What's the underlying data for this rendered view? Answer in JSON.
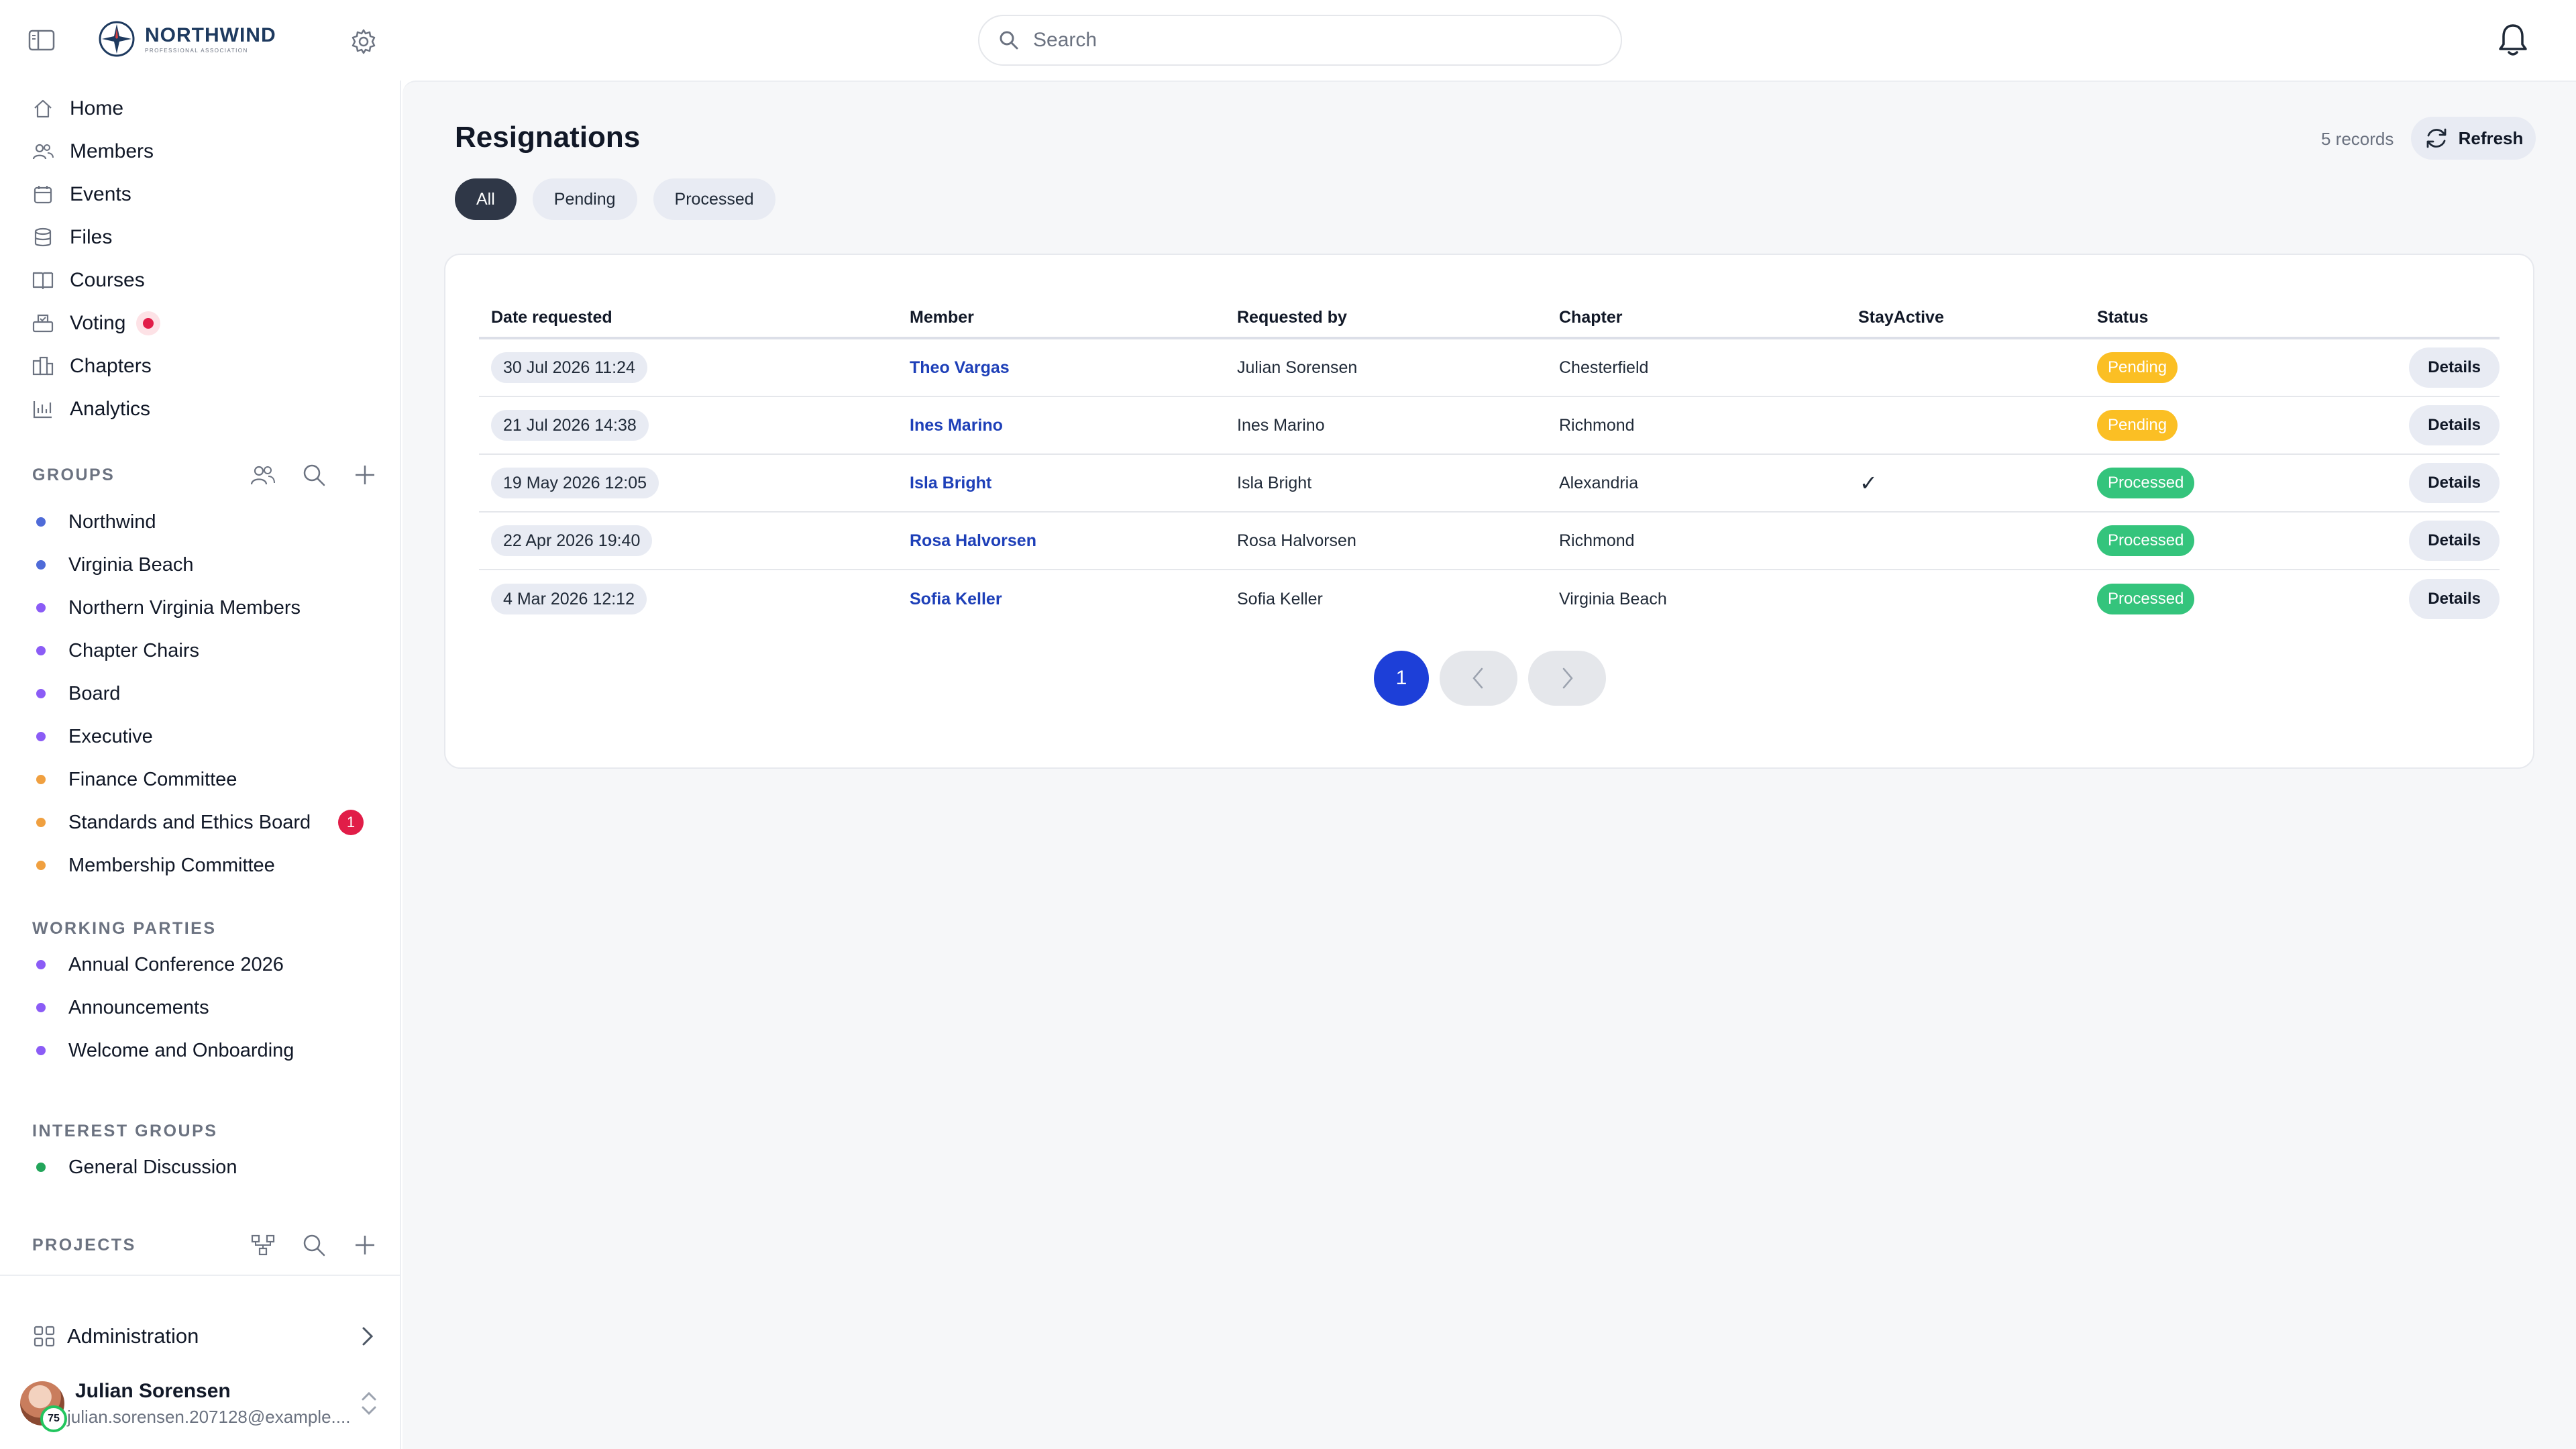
{
  "brand": {
    "name": "NORTHWIND",
    "subtitle": "PROFESSIONAL ASSOCIATION"
  },
  "search": {
    "placeholder": "Search"
  },
  "nav": [
    {
      "label": "Home",
      "icon": "home-icon"
    },
    {
      "label": "Members",
      "icon": "users-icon"
    },
    {
      "label": "Events",
      "icon": "calendar-icon"
    },
    {
      "label": "Files",
      "icon": "database-icon"
    },
    {
      "label": "Courses",
      "icon": "book-icon"
    },
    {
      "label": "Voting",
      "icon": "ballot-icon",
      "indicator": true
    },
    {
      "label": "Chapters",
      "icon": "chapters-icon"
    },
    {
      "label": "Analytics",
      "icon": "analytics-icon"
    }
  ],
  "groups": {
    "title": "GROUPS",
    "items": [
      {
        "label": "Northwind",
        "color": "#4f6bd8"
      },
      {
        "label": "Virginia Beach",
        "color": "#4f6bd8"
      },
      {
        "label": "Northern Virginia Members",
        "color": "#8b5cf6"
      },
      {
        "label": "Chapter Chairs",
        "color": "#8b5cf6"
      },
      {
        "label": "Board",
        "color": "#8b5cf6"
      },
      {
        "label": "Executive",
        "color": "#8b5cf6"
      },
      {
        "label": "Finance Committee",
        "color": "#f0a040"
      },
      {
        "label": "Standards and Ethics Board",
        "color": "#f0a040",
        "count": "1"
      },
      {
        "label": "Membership Committee",
        "color": "#f0a040"
      }
    ]
  },
  "working_parties": {
    "title": "WORKING PARTIES",
    "items": [
      {
        "label": "Annual Conference 2026",
        "color": "#8b5cf6"
      },
      {
        "label": "Announcements",
        "color": "#8b5cf6"
      },
      {
        "label": "Welcome and Onboarding",
        "color": "#8b5cf6"
      }
    ]
  },
  "interest_groups": {
    "title": "INTEREST GROUPS",
    "items": [
      {
        "label": "General Discussion",
        "color": "#22a55a"
      }
    ]
  },
  "projects": {
    "title": "PROJECTS"
  },
  "admin": {
    "label": "Administration"
  },
  "user": {
    "name": "Julian Sorensen",
    "email": "julian.sorensen.207128@example....",
    "badge": "75"
  },
  "page": {
    "title": "Resignations",
    "records": "5 records",
    "refresh_label": "Refresh",
    "filters": [
      "All",
      "Pending",
      "Processed"
    ],
    "active_filter": "All"
  },
  "table": {
    "headers": [
      "Date requested",
      "Member",
      "Requested by",
      "Chapter",
      "StayActive",
      "Status",
      ""
    ],
    "rows": [
      {
        "date": "30 Jul 2026 11:24",
        "member": "Theo Vargas",
        "requested_by": "Julian Sorensen",
        "chapter": "Chesterfield",
        "stay_active": "",
        "status": "Pending",
        "action": "Details"
      },
      {
        "date": "21 Jul 2026 14:38",
        "member": "Ines Marino",
        "requested_by": "Ines Marino",
        "chapter": "Richmond",
        "stay_active": "",
        "status": "Pending",
        "action": "Details"
      },
      {
        "date": "19 May 2026 12:05",
        "member": "Isla Bright",
        "requested_by": "Isla Bright",
        "chapter": "Alexandria",
        "stay_active": "✓",
        "status": "Processed",
        "action": "Details"
      },
      {
        "date": "22 Apr 2026 19:40",
        "member": "Rosa Halvorsen",
        "requested_by": "Rosa Halvorsen",
        "chapter": "Richmond",
        "stay_active": "",
        "status": "Processed",
        "action": "Details"
      },
      {
        "date": "4 Mar 2026 12:12",
        "member": "Sofia Keller",
        "requested_by": "Sofia Keller",
        "chapter": "Virginia Beach",
        "stay_active": "",
        "status": "Processed",
        "action": "Details"
      }
    ]
  },
  "pagination": {
    "current": "1"
  }
}
